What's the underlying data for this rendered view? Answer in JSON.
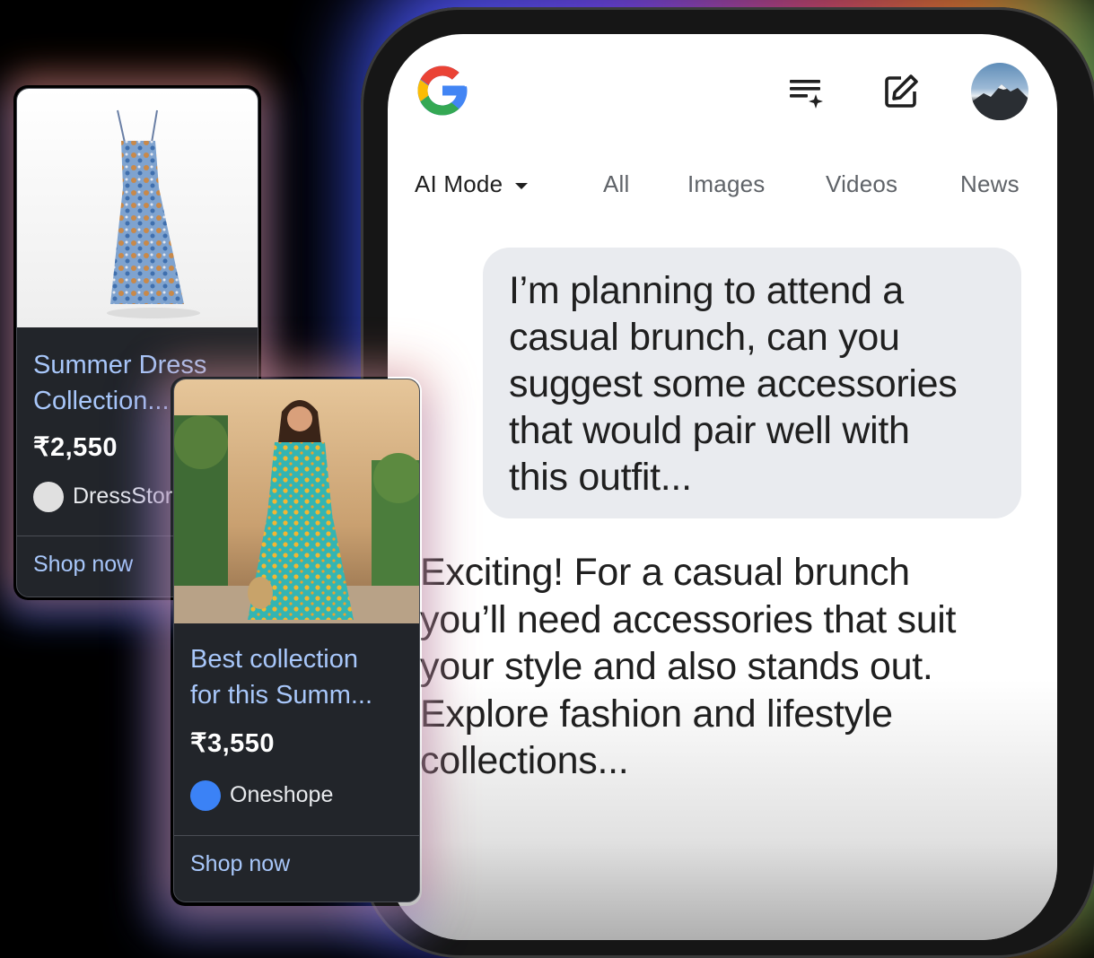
{
  "header": {
    "logo_icon": "google-g-logo",
    "history_icon": "sparkle-list-icon",
    "new_chat_icon": "edit-square-icon",
    "avatar_icon": "mountain-avatar"
  },
  "tabs": [
    {
      "label": "AI Mode",
      "active": true
    },
    {
      "label": "All",
      "active": false
    },
    {
      "label": "Images",
      "active": false
    },
    {
      "label": "Videos",
      "active": false
    },
    {
      "label": "News",
      "active": false
    }
  ],
  "chat": {
    "user_lines": [
      "I’m planning to attend a",
      "casual brunch, can you",
      "suggest some accessories",
      "that would pair well with",
      "this outfit..."
    ],
    "answer_lines": [
      "Exciting! For a casual brunch",
      "you’ll need accessories that suit",
      "your style and also stands out.",
      "Explore fashion and lifestyle",
      "collections..."
    ]
  },
  "cards": [
    {
      "title_lines": [
        "Summer Dress",
        "Collection..."
      ],
      "price": "₹2,550",
      "store": "DressStor",
      "store_dot_color": "#e0e0e0",
      "cta": "Shop now"
    },
    {
      "title_lines": [
        "Best collection",
        "for this Summ..."
      ],
      "price": "₹3,550",
      "store": "Oneshope",
      "store_dot_color": "#3b82f6",
      "cta": "Shop now"
    }
  ],
  "colors": {
    "link_blue": "#a8c7fa",
    "card_bg": "#22252a",
    "bubble_bg": "#e9ebef"
  }
}
